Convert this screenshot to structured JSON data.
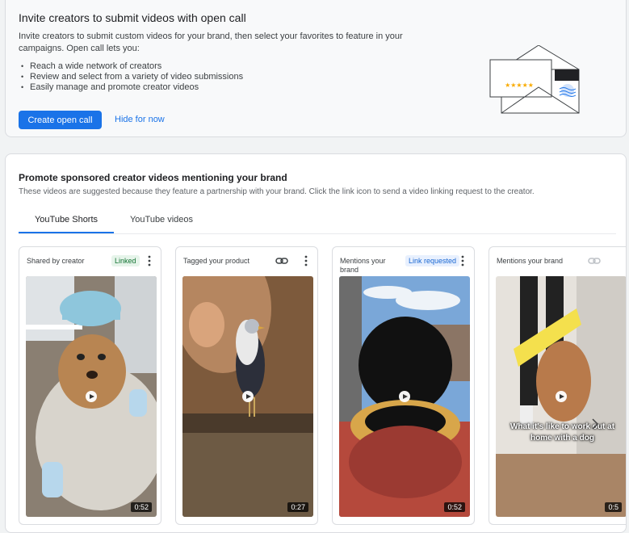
{
  "invite": {
    "title": "Invite creators to submit videos with open call",
    "description": "Invite creators to submit custom videos for your brand, then select your favorites to feature in your campaigns. Open call lets you:",
    "bullets": [
      "Reach a wide network  of creators",
      "Review and select from a variety of video submissions",
      "Easily manage and promote creator videos"
    ],
    "create_button": "Create open call",
    "hide_link": "Hide for now",
    "rating_stars": "★★★★★"
  },
  "promote": {
    "title": "Promote sponsored creator videos mentioning your brand",
    "subtitle": "These videos are suggested because they feature a partnership with your brand. Click the link icon to send a video linking request to the creator.",
    "tabs": [
      "YouTube Shorts",
      "YouTube videos"
    ],
    "active_tab": "YouTube Shorts",
    "videos": [
      {
        "label": "Shared by creator",
        "badge": "Linked",
        "duration": "0:52"
      },
      {
        "label": "Tagged your product",
        "duration": "0:27"
      },
      {
        "label": "Mentions your brand",
        "badge": "Link requested",
        "duration": "0:52"
      },
      {
        "label": "Mentions your brand",
        "caption": "What it's like to work out at home with a dog",
        "duration": "0:5"
      }
    ]
  },
  "colors": {
    "primary": "#1a73e8",
    "linked_green": "#137333",
    "resistance_band": "#f4e04d"
  }
}
